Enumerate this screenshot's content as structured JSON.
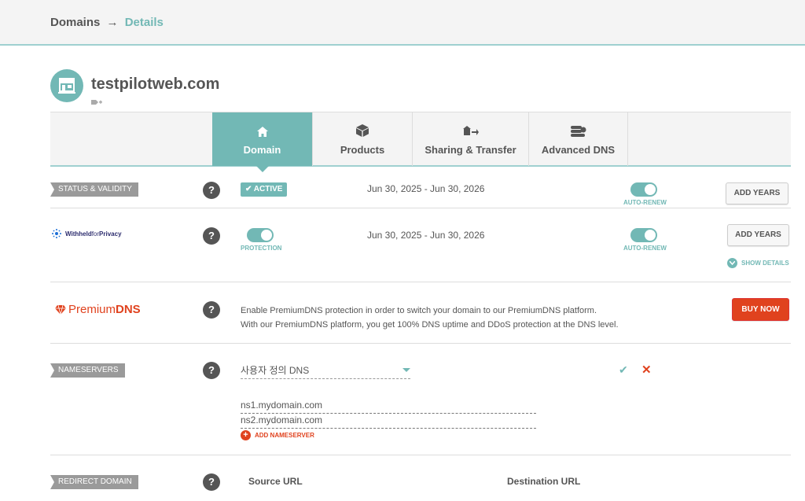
{
  "breadcrumb": {
    "root": "Domains",
    "arrow": "→",
    "current": "Details"
  },
  "domain": {
    "name": "testpilotweb.com"
  },
  "tabs": [
    {
      "label": "Domain",
      "icon": "house-icon",
      "active": true
    },
    {
      "label": "Products",
      "icon": "box-icon"
    },
    {
      "label": "Sharing & Transfer",
      "icon": "transfer-icon"
    },
    {
      "label": "Advanced DNS",
      "icon": "server-icon"
    }
  ],
  "status": {
    "label": "STATUS & VALIDITY",
    "help": "?",
    "badge": "ACTIVE",
    "dates": "Jun 30, 2025 - Jun 30, 2026",
    "autorenew_label": "AUTO-RENEW",
    "autorenew_on": true,
    "add_years": "ADD YEARS"
  },
  "privacy": {
    "brand_bold": "Withheld",
    "brand_light": "for",
    "brand_bold2": "Privacy",
    "help": "?",
    "protection_label": "PROTECTION",
    "protection_on": true,
    "dates": "Jun 30, 2025 - Jun 30, 2026",
    "autorenew_label": "AUTO-RENEW",
    "autorenew_on": true,
    "add_years": "ADD YEARS",
    "show_details": "SHOW DETAILS"
  },
  "premiumdns": {
    "brand_light": "Premium",
    "brand_bold": "DNS",
    "help": "?",
    "line1": "Enable PremiumDNS protection in order to switch your domain to our PremiumDNS platform.",
    "line2": "With our PremiumDNS platform, you get 100% DNS uptime and DDoS protection at the DNS level.",
    "buy_now": "BUY NOW"
  },
  "nameservers": {
    "label": "NAMESERVERS",
    "help": "?",
    "selected": "사용자 정의 DNS",
    "ns1": "ns1.mydomain.com",
    "ns2": "ns2.mydomain.com",
    "add": "ADD NAMESERVER"
  },
  "redirect": {
    "label": "REDIRECT DOMAIN",
    "help": "?",
    "source": "Source URL",
    "destination": "Destination URL"
  },
  "colors": {
    "accent": "#72b8b5",
    "danger": "#e0421e",
    "label_bg": "#9a9a9a"
  }
}
